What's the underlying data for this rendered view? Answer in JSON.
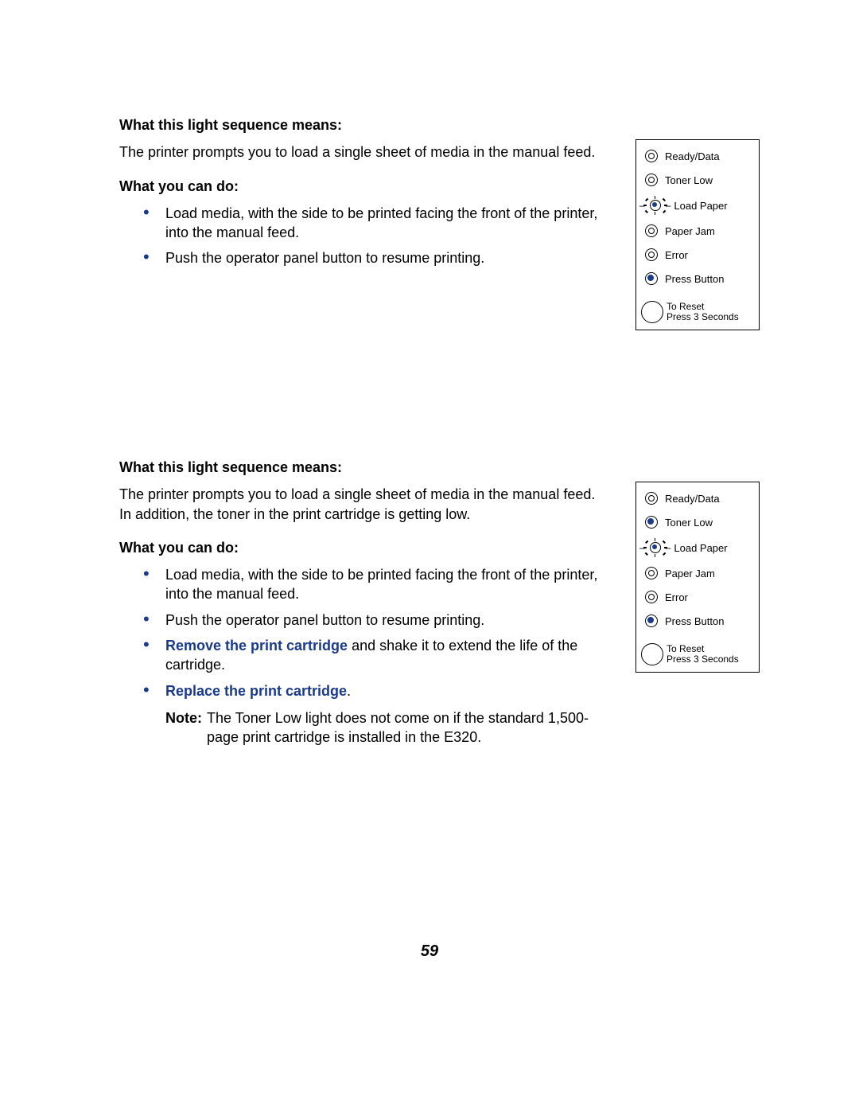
{
  "page_number": "59",
  "sections": [
    {
      "heading1": "What this light sequence means:",
      "desc": "The printer prompts you to load a single sheet of media in the manual feed.",
      "heading2": "What you can do:",
      "bullets": [
        {
          "text": "Load media, with the side to be printed facing the front of the printer, into the manual feed."
        },
        {
          "text": "Push the operator panel button to resume printing."
        }
      ],
      "panel": {
        "lights": [
          {
            "state": "off",
            "label": "Ready/Data"
          },
          {
            "state": "off",
            "label": "Toner Low"
          },
          {
            "state": "blink",
            "label": "Load Paper"
          },
          {
            "state": "off",
            "label": "Paper Jam"
          },
          {
            "state": "off",
            "label": "Error"
          },
          {
            "state": "on",
            "label": "Press Button"
          }
        ],
        "reset_line1": "To Reset",
        "reset_line2": "Press 3 Seconds"
      }
    },
    {
      "heading1": "What this light sequence means:",
      "desc": "The printer prompts you to load a single sheet of media in the manual feed. In addition, the toner in the print cartridge is getting low.",
      "heading2": "What you can do:",
      "bullets": [
        {
          "text": "Load media, with the side to be printed facing the front of the printer, into the manual feed."
        },
        {
          "text": "Push the operator panel button to resume printing."
        },
        {
          "link_text": "Remove the print cartridge",
          "rest": " and shake it to extend the life of the cartridge."
        },
        {
          "link_text": "Replace the print cartridge",
          "rest": "."
        }
      ],
      "note": {
        "label": "Note:",
        "text": "The Toner Low light does not come on if the standard 1,500-page print cartridge is installed in the E320."
      },
      "panel": {
        "lights": [
          {
            "state": "off",
            "label": "Ready/Data"
          },
          {
            "state": "on",
            "label": "Toner Low"
          },
          {
            "state": "blink",
            "label": "Load Paper"
          },
          {
            "state": "off",
            "label": "Paper Jam"
          },
          {
            "state": "off",
            "label": "Error"
          },
          {
            "state": "on",
            "label": "Press Button"
          }
        ],
        "reset_line1": "To Reset",
        "reset_line2": "Press 3 Seconds"
      }
    }
  ]
}
